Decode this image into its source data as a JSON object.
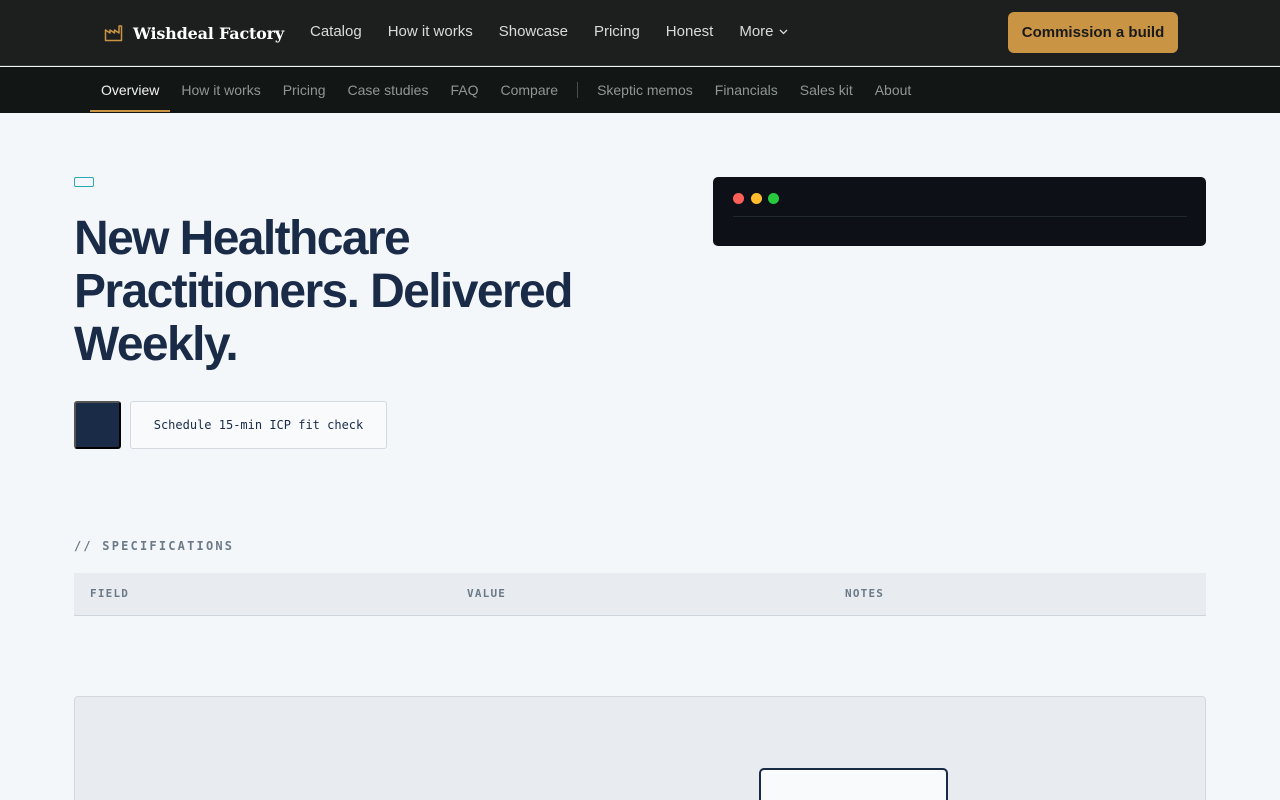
{
  "header": {
    "brand_name": "Wishdeal Factory",
    "brand_icon": "factory-icon",
    "nav": [
      {
        "label": "Catalog"
      },
      {
        "label": "How it works"
      },
      {
        "label": "Showcase"
      },
      {
        "label": "Pricing"
      },
      {
        "label": "Honest"
      },
      {
        "label": "More"
      }
    ],
    "cta_label": "Commission a build"
  },
  "subnav": {
    "items": [
      {
        "label": "Overview",
        "active": true
      },
      {
        "label": "How it works"
      },
      {
        "label": "Pricing"
      },
      {
        "label": "Case studies"
      },
      {
        "label": "FAQ"
      },
      {
        "label": "Compare"
      },
      {
        "label": "Skeptic memos"
      },
      {
        "label": "Financials"
      },
      {
        "label": "Sales kit"
      },
      {
        "label": "About"
      }
    ]
  },
  "hero": {
    "title": "New Healthcare Practitioners. Delivered Weekly.",
    "secondary_button": "Schedule 15-min ICP fit check"
  },
  "specs": {
    "label": "// SPECIFICATIONS",
    "columns": [
      "FIELD",
      "VALUE",
      "NOTES"
    ]
  },
  "colors": {
    "accent": "#c99444",
    "navy": "#1a2b48",
    "teal": "#2aa6b4",
    "traffic_red": "#ff5f56",
    "traffic_yellow": "#ffbd2e",
    "traffic_green": "#27c93f"
  }
}
